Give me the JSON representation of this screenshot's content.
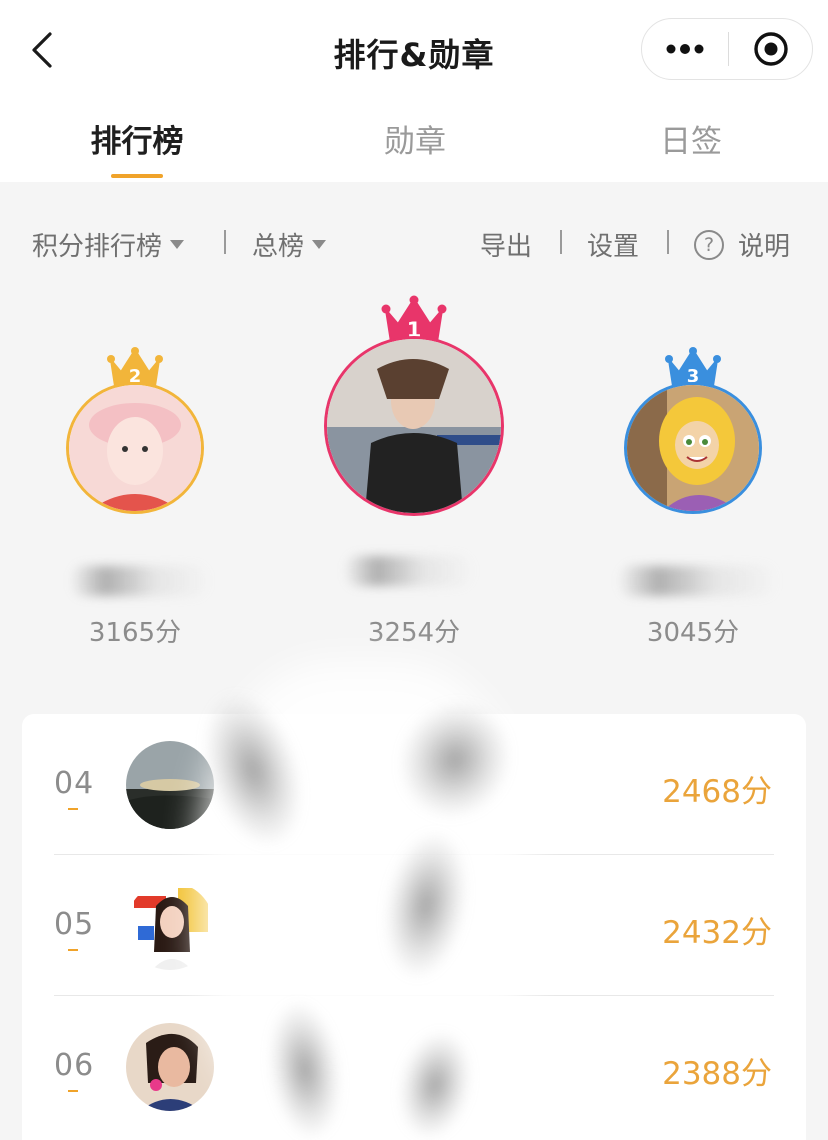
{
  "nav": {
    "title": "排行&勋章",
    "back_icon": "chevron-left-icon",
    "more_icon": "more-dots-icon",
    "close_icon": "target-close-icon"
  },
  "tabs": [
    {
      "label": "排行榜",
      "active": true
    },
    {
      "label": "勋章",
      "active": false
    },
    {
      "label": "日签",
      "active": false
    }
  ],
  "filters": {
    "ranking_type": "积分排行榜",
    "period": "总榜",
    "export": "导出",
    "settings": "设置",
    "help": "说明",
    "help_glyph": "?"
  },
  "podium": [
    {
      "rank": "2",
      "score": "3165分",
      "color": "#f2b53a"
    },
    {
      "rank": "1",
      "score": "3254分",
      "color": "#e8356a"
    },
    {
      "rank": "3",
      "score": "3045分",
      "color": "#3a8fde"
    }
  ],
  "list": [
    {
      "rank": "04",
      "score": "2468分"
    },
    {
      "rank": "05",
      "score": "2432分"
    },
    {
      "rank": "06",
      "score": "2388分"
    }
  ],
  "colors": {
    "accent": "#f0a32a",
    "score": "#eaa43b",
    "gold": "#f2b53a",
    "pink": "#e8356a",
    "blue": "#3a8fde"
  }
}
